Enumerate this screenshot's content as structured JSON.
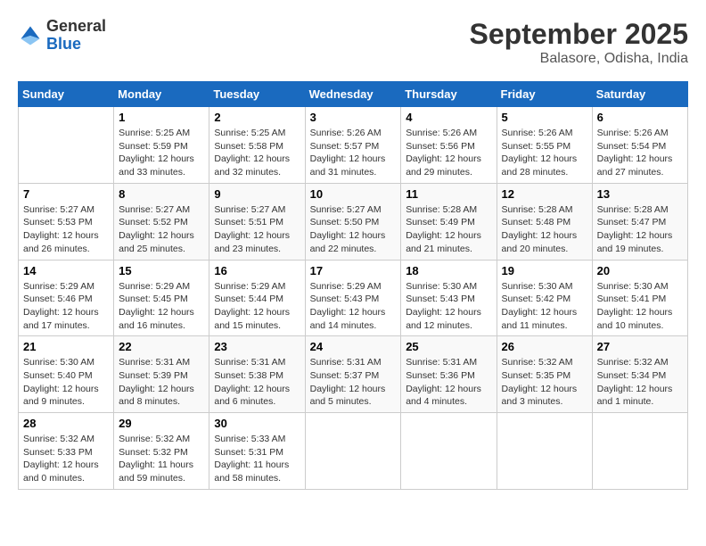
{
  "header": {
    "logo": {
      "general": "General",
      "blue": "Blue"
    },
    "title": "September 2025",
    "location": "Balasore, Odisha, India"
  },
  "days_of_week": [
    "Sunday",
    "Monday",
    "Tuesday",
    "Wednesday",
    "Thursday",
    "Friday",
    "Saturday"
  ],
  "weeks": [
    [
      null,
      {
        "day": "1",
        "sunrise": "5:25 AM",
        "sunset": "5:59 PM",
        "daylight": "12 hours and 33 minutes."
      },
      {
        "day": "2",
        "sunrise": "5:25 AM",
        "sunset": "5:58 PM",
        "daylight": "12 hours and 32 minutes."
      },
      {
        "day": "3",
        "sunrise": "5:26 AM",
        "sunset": "5:57 PM",
        "daylight": "12 hours and 31 minutes."
      },
      {
        "day": "4",
        "sunrise": "5:26 AM",
        "sunset": "5:56 PM",
        "daylight": "12 hours and 29 minutes."
      },
      {
        "day": "5",
        "sunrise": "5:26 AM",
        "sunset": "5:55 PM",
        "daylight": "12 hours and 28 minutes."
      },
      {
        "day": "6",
        "sunrise": "5:26 AM",
        "sunset": "5:54 PM",
        "daylight": "12 hours and 27 minutes."
      }
    ],
    [
      {
        "day": "7",
        "sunrise": "5:27 AM",
        "sunset": "5:53 PM",
        "daylight": "12 hours and 26 minutes."
      },
      {
        "day": "8",
        "sunrise": "5:27 AM",
        "sunset": "5:52 PM",
        "daylight": "12 hours and 25 minutes."
      },
      {
        "day": "9",
        "sunrise": "5:27 AM",
        "sunset": "5:51 PM",
        "daylight": "12 hours and 23 minutes."
      },
      {
        "day": "10",
        "sunrise": "5:27 AM",
        "sunset": "5:50 PM",
        "daylight": "12 hours and 22 minutes."
      },
      {
        "day": "11",
        "sunrise": "5:28 AM",
        "sunset": "5:49 PM",
        "daylight": "12 hours and 21 minutes."
      },
      {
        "day": "12",
        "sunrise": "5:28 AM",
        "sunset": "5:48 PM",
        "daylight": "12 hours and 20 minutes."
      },
      {
        "day": "13",
        "sunrise": "5:28 AM",
        "sunset": "5:47 PM",
        "daylight": "12 hours and 19 minutes."
      }
    ],
    [
      {
        "day": "14",
        "sunrise": "5:29 AM",
        "sunset": "5:46 PM",
        "daylight": "12 hours and 17 minutes."
      },
      {
        "day": "15",
        "sunrise": "5:29 AM",
        "sunset": "5:45 PM",
        "daylight": "12 hours and 16 minutes."
      },
      {
        "day": "16",
        "sunrise": "5:29 AM",
        "sunset": "5:44 PM",
        "daylight": "12 hours and 15 minutes."
      },
      {
        "day": "17",
        "sunrise": "5:29 AM",
        "sunset": "5:43 PM",
        "daylight": "12 hours and 14 minutes."
      },
      {
        "day": "18",
        "sunrise": "5:30 AM",
        "sunset": "5:43 PM",
        "daylight": "12 hours and 12 minutes."
      },
      {
        "day": "19",
        "sunrise": "5:30 AM",
        "sunset": "5:42 PM",
        "daylight": "12 hours and 11 minutes."
      },
      {
        "day": "20",
        "sunrise": "5:30 AM",
        "sunset": "5:41 PM",
        "daylight": "12 hours and 10 minutes."
      }
    ],
    [
      {
        "day": "21",
        "sunrise": "5:30 AM",
        "sunset": "5:40 PM",
        "daylight": "12 hours and 9 minutes."
      },
      {
        "day": "22",
        "sunrise": "5:31 AM",
        "sunset": "5:39 PM",
        "daylight": "12 hours and 8 minutes."
      },
      {
        "day": "23",
        "sunrise": "5:31 AM",
        "sunset": "5:38 PM",
        "daylight": "12 hours and 6 minutes."
      },
      {
        "day": "24",
        "sunrise": "5:31 AM",
        "sunset": "5:37 PM",
        "daylight": "12 hours and 5 minutes."
      },
      {
        "day": "25",
        "sunrise": "5:31 AM",
        "sunset": "5:36 PM",
        "daylight": "12 hours and 4 minutes."
      },
      {
        "day": "26",
        "sunrise": "5:32 AM",
        "sunset": "5:35 PM",
        "daylight": "12 hours and 3 minutes."
      },
      {
        "day": "27",
        "sunrise": "5:32 AM",
        "sunset": "5:34 PM",
        "daylight": "12 hours and 1 minute."
      }
    ],
    [
      {
        "day": "28",
        "sunrise": "5:32 AM",
        "sunset": "5:33 PM",
        "daylight": "12 hours and 0 minutes."
      },
      {
        "day": "29",
        "sunrise": "5:32 AM",
        "sunset": "5:32 PM",
        "daylight": "11 hours and 59 minutes."
      },
      {
        "day": "30",
        "sunrise": "5:33 AM",
        "sunset": "5:31 PM",
        "daylight": "11 hours and 58 minutes."
      },
      null,
      null,
      null,
      null
    ]
  ]
}
